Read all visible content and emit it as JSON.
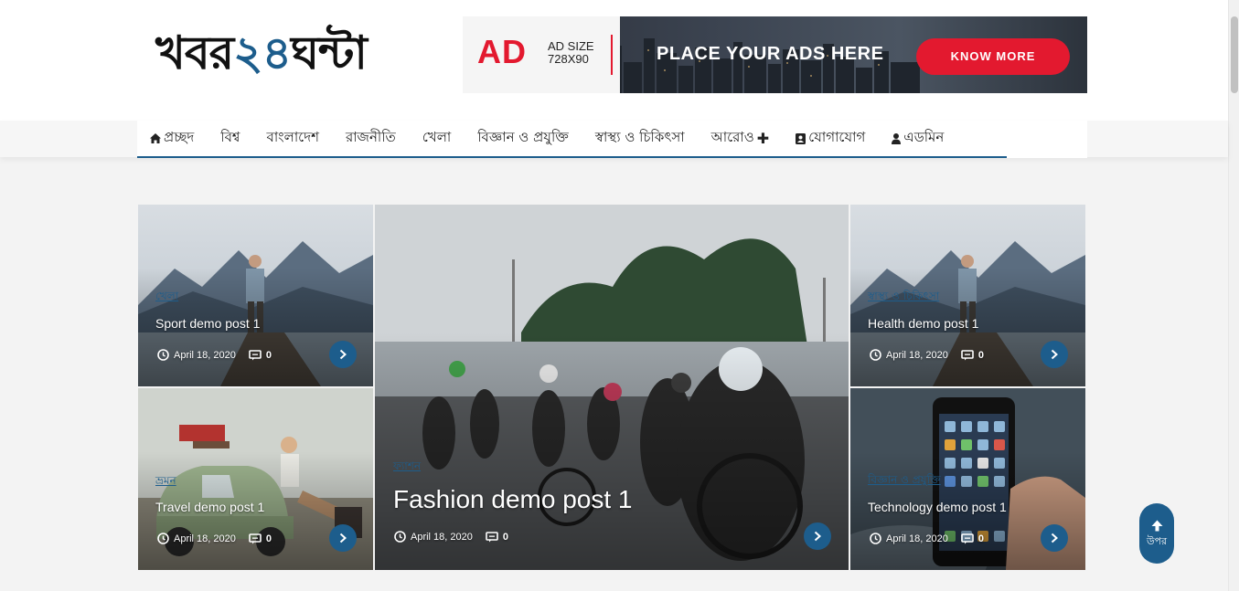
{
  "site": {
    "logo_part1": "খবর",
    "logo_part2": "২৪",
    "logo_part3": "ঘন্টা"
  },
  "ad": {
    "ad_word": "AD",
    "size_line1": "AD SIZE",
    "size_line2": "728X90",
    "headline": "PLACE YOUR ADS HERE",
    "button": "KNOW MORE"
  },
  "nav": {
    "items": [
      {
        "label": "প্রচ্ছদ",
        "icon": "home-icon"
      },
      {
        "label": "বিশ্ব"
      },
      {
        "label": "বাংলাদেশ"
      },
      {
        "label": "রাজনীতি"
      },
      {
        "label": "খেলা"
      },
      {
        "label": "বিজ্ঞান ও প্রযুক্তি"
      },
      {
        "label": "স্বাস্থ্য ও চিকিৎসা"
      },
      {
        "label": "আরোও",
        "icon": "plus-icon"
      },
      {
        "label": "যোগাযোগ",
        "icon": "contact-icon"
      },
      {
        "label": "এডমিন",
        "icon": "user-icon"
      }
    ]
  },
  "posts": {
    "sport": {
      "category": "খেলা",
      "title": "Sport demo post 1",
      "date": "April 18, 2020",
      "comments": "0"
    },
    "travel": {
      "category": "ভ্রমন",
      "title": "Travel demo post 1",
      "date": "April 18, 2020",
      "comments": "0"
    },
    "fashion": {
      "category": "ফ্যাশন",
      "title": "Fashion demo post 1",
      "date": "April 18, 2020",
      "comments": "0"
    },
    "health": {
      "category": "স্বাস্থ্য ও চিকিৎসা",
      "title": "Health demo post 1",
      "date": "April 18, 2020",
      "comments": "0"
    },
    "technology": {
      "category": "বিজ্ঞান ও প্রযুক্তি",
      "title": "Technology demo post 1",
      "date": "April 18, 2020",
      "comments": "0"
    }
  },
  "back_to_top": {
    "label": "উপর"
  },
  "colors": {
    "accent": "#1d5d8c",
    "ad_red": "#e3192f"
  }
}
